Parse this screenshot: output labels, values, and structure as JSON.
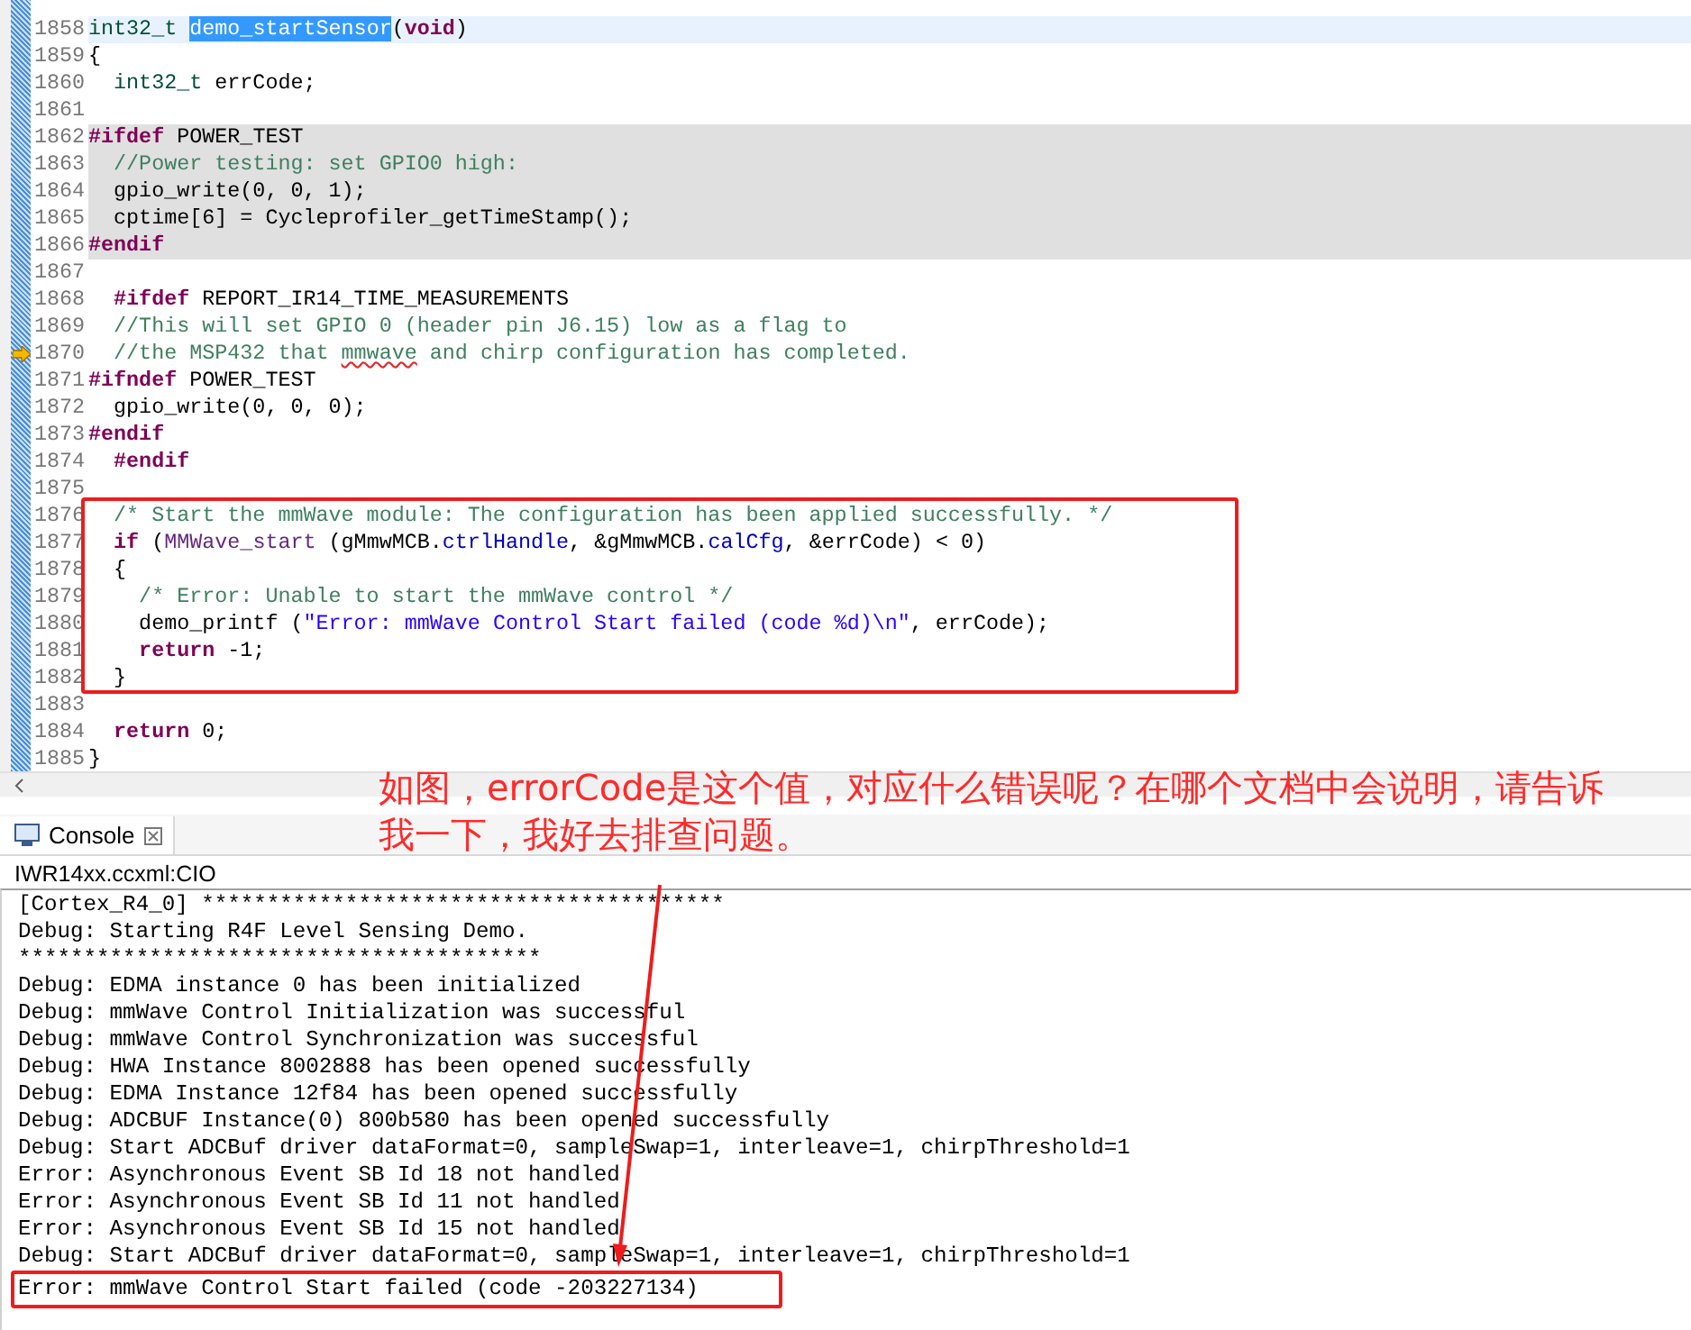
{
  "editor": {
    "lines": [
      {
        "number": "1858",
        "current": true,
        "shaded": false,
        "marker": false,
        "segments": [
          {
            "kind": "type",
            "text": "int32_t"
          },
          {
            "kind": "selection",
            "text": " demo_startSensor"
          },
          {
            "kind": "plain",
            "text": "("
          },
          {
            "kind": "keyword",
            "text": "void"
          },
          {
            "kind": "plain",
            "text": ")"
          }
        ]
      },
      {
        "number": "1859",
        "current": false,
        "shaded": false,
        "marker": false,
        "segments": [
          {
            "kind": "plain",
            "text": "{"
          }
        ]
      },
      {
        "number": "1860",
        "current": false,
        "shaded": false,
        "marker": false,
        "segments": [
          {
            "kind": "type",
            "text": "  int32_t"
          },
          {
            "kind": "plain",
            "text": " errCode;"
          }
        ]
      },
      {
        "number": "1861",
        "current": false,
        "shaded": false,
        "marker": false
      },
      {
        "number": "1862",
        "current": false,
        "shaded": true,
        "marker": false,
        "segments": [
          {
            "kind": "preproc",
            "text": "#ifdef"
          },
          {
            "kind": "plain",
            "text": " POWER_TEST"
          }
        ]
      },
      {
        "number": "1863",
        "current": false,
        "shaded": true,
        "marker": false,
        "segments": [
          {
            "kind": "comment",
            "text": "  //Power testing: set GPIO0 high:"
          }
        ]
      },
      {
        "number": "1864",
        "current": false,
        "shaded": true,
        "marker": false,
        "segments": [
          {
            "kind": "plain",
            "text": "  gpio_write(0, 0, 1);"
          }
        ]
      },
      {
        "number": "1865",
        "current": false,
        "shaded": true,
        "marker": false,
        "segments": [
          {
            "kind": "plain",
            "text": "  cptime[6] = Cycleprofiler_getTimeStamp();"
          }
        ]
      },
      {
        "number": "1866",
        "current": false,
        "shaded": true,
        "marker": false,
        "segments": [
          {
            "kind": "preproc",
            "text": "#endif"
          }
        ]
      },
      {
        "number": "1867",
        "current": false,
        "shaded": false,
        "marker": false
      },
      {
        "number": "1868",
        "current": false,
        "shaded": false,
        "marker": false,
        "segments": [
          {
            "kind": "preproc",
            "text": "  #ifdef"
          },
          {
            "kind": "plain",
            "text": " REPORT_IR14_TIME_MEASUREMENTS"
          }
        ]
      },
      {
        "number": "1869",
        "current": false,
        "shaded": false,
        "marker": false,
        "segments": [
          {
            "kind": "comment",
            "text": "  //This will set GPIO 0 (header pin J6.15) low as a flag to"
          }
        ]
      },
      {
        "number": "1870",
        "current": false,
        "shaded": false,
        "marker": true,
        "segments": [
          {
            "kind": "comment",
            "text": "  //the MSP432 that "
          },
          {
            "kind": "misspelled",
            "text": "mmwave"
          },
          {
            "kind": "comment",
            "text": " and chirp configuration has completed."
          }
        ]
      },
      {
        "number": "1871",
        "current": false,
        "shaded": false,
        "marker": false,
        "segments": [
          {
            "kind": "preproc",
            "text": "#ifndef"
          },
          {
            "kind": "plain",
            "text": " POWER_TEST"
          }
        ]
      },
      {
        "number": "1872",
        "current": false,
        "shaded": false,
        "marker": false,
        "segments": [
          {
            "kind": "plain",
            "text": "  gpio_write(0, 0, 0);"
          }
        ]
      },
      {
        "number": "1873",
        "current": false,
        "shaded": false,
        "marker": false,
        "segments": [
          {
            "kind": "preproc",
            "text": "#endif"
          }
        ]
      },
      {
        "number": "1874",
        "current": false,
        "shaded": false,
        "marker": false,
        "segments": [
          {
            "kind": "preproc",
            "text": "  #endif"
          }
        ]
      },
      {
        "number": "1875",
        "current": false,
        "shaded": false,
        "marker": false
      },
      {
        "number": "1876",
        "current": false,
        "shaded": false,
        "marker": false,
        "segments": [
          {
            "kind": "comment",
            "text": "  /* Start the mmWave module: The configuration has been applied successfully. */"
          }
        ]
      },
      {
        "number": "1877",
        "current": false,
        "shaded": false,
        "marker": false,
        "segments": [
          {
            "kind": "keyword",
            "text": "  if"
          },
          {
            "kind": "plain",
            "text": " ("
          },
          {
            "kind": "func",
            "text": "MMWave_start"
          },
          {
            "kind": "plain",
            "text": " (gMmwMCB."
          },
          {
            "kind": "field",
            "text": "ctrlHandle"
          },
          {
            "kind": "plain",
            "text": ", &gMmwMCB."
          },
          {
            "kind": "field",
            "text": "calCfg"
          },
          {
            "kind": "plain",
            "text": ", &errCode) < 0)"
          }
        ]
      },
      {
        "number": "1878",
        "current": false,
        "shaded": false,
        "marker": false,
        "segments": [
          {
            "kind": "plain",
            "text": "  {"
          }
        ]
      },
      {
        "number": "1879",
        "current": false,
        "shaded": false,
        "marker": false,
        "segments": [
          {
            "kind": "comment",
            "text": "    /* Error: Unable to start the mmWave control */"
          }
        ]
      },
      {
        "number": "1880",
        "current": false,
        "shaded": false,
        "marker": false,
        "segments": [
          {
            "kind": "plain",
            "text": "    demo_printf ("
          },
          {
            "kind": "string",
            "text": "\"Error: mmWave Control Start failed (code %d)\\n\""
          },
          {
            "kind": "plain",
            "text": ", errCode);"
          }
        ]
      },
      {
        "number": "1881",
        "current": false,
        "shaded": false,
        "marker": false,
        "segments": [
          {
            "kind": "keyword",
            "text": "    return"
          },
          {
            "kind": "plain",
            "text": " -1;"
          }
        ]
      },
      {
        "number": "1882",
        "current": false,
        "shaded": false,
        "marker": false,
        "segments": [
          {
            "kind": "plain",
            "text": "  }"
          }
        ]
      },
      {
        "number": "1883",
        "current": false,
        "shaded": false,
        "marker": false
      },
      {
        "number": "1884",
        "current": false,
        "shaded": false,
        "marker": false,
        "segments": [
          {
            "kind": "keyword",
            "text": "  return"
          },
          {
            "kind": "plain",
            "text": " 0;"
          }
        ]
      },
      {
        "number": "1885",
        "current": false,
        "shaded": false,
        "marker": false,
        "segments": [
          {
            "kind": "plain",
            "text": "}"
          }
        ]
      }
    ]
  },
  "console": {
    "tab": {
      "label": "Console",
      "selected": true
    },
    "source": "IWR14xx.ccxml:CIO",
    "lines": [
      {
        "text": "[Cortex_R4_0] ****************************************",
        "highlighted": false
      },
      {
        "text": "Debug: Starting R4F Level Sensing Demo.",
        "highlighted": false
      },
      {
        "text": "****************************************",
        "highlighted": false
      },
      {
        "text": "Debug: EDMA instance 0 has been initialized",
        "highlighted": false
      },
      {
        "text": "Debug: mmWave Control Initialization was successful",
        "highlighted": false
      },
      {
        "text": "Debug: mmWave Control Synchronization was successful",
        "highlighted": false
      },
      {
        "text": "Debug: HWA Instance 8002888 has been opened successfully",
        "highlighted": false
      },
      {
        "text": "Debug: EDMA Instance 12f84 has been opened successfully",
        "highlighted": false
      },
      {
        "text": "Debug: ADCBUF Instance(0) 800b580 has been opened successfully",
        "highlighted": false
      },
      {
        "text": "Debug: Start ADCBuf driver dataFormat=0, sampleSwap=1, interleave=1, chirpThreshold=1",
        "highlighted": false
      },
      {
        "text": "Error: Asynchronous Event SB Id 18 not handled",
        "highlighted": false
      },
      {
        "text": "Error: Asynchronous Event SB Id 11 not handled",
        "highlighted": false
      },
      {
        "text": "Error: Asynchronous Event SB Id 15 not handled",
        "highlighted": false
      },
      {
        "text": "Debug: Start ADCBuf driver dataFormat=0, sampleSwap=1, interleave=1, chirpThreshold=1",
        "highlighted": false
      },
      {
        "text": "Error: mmWave Control Start failed (code -203227134)",
        "highlighted": true
      }
    ]
  },
  "annotation": {
    "note": "如图，errorCode是这个值，对应什么错误呢？在哪个文档中会说明，请告诉我一下，我好去排查问题。"
  }
}
